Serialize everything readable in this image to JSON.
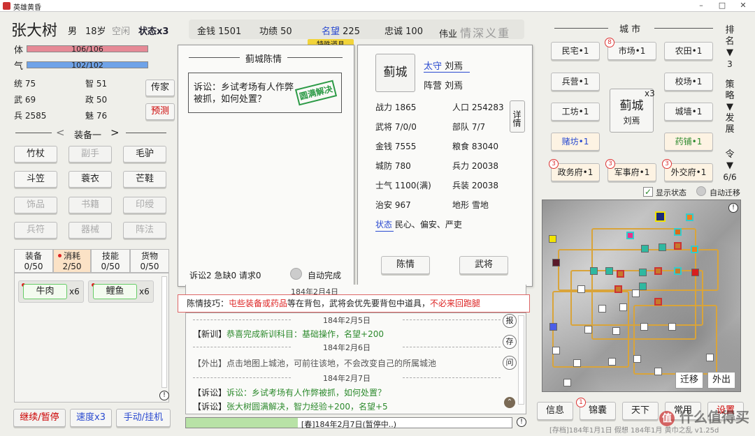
{
  "window": {
    "title": "英雄黄昏",
    "controls": [
      "–",
      "□",
      "✕"
    ]
  },
  "hero": {
    "name": "张大树",
    "gender": "男",
    "age": "18岁",
    "state": "空闲",
    "status": "状态x3"
  },
  "bars": {
    "hp_label": "体",
    "hp_text": "106/106",
    "hp_fraction": 1.0,
    "qi_label": "气",
    "qi_text": "102/102",
    "qi_fraction": 1.0,
    "hp_color": "#e68a96",
    "qi_color": "#6fa3e8"
  },
  "attrs": [
    {
      "l": "统",
      "v": "75"
    },
    {
      "l": "智",
      "v": "51"
    },
    {
      "l": "武",
      "v": "69"
    },
    {
      "l": "政",
      "v": "50"
    },
    {
      "l": "兵",
      "v": "2585"
    },
    {
      "l": "魅",
      "v": "76"
    }
  ],
  "hero_buttons": {
    "chuanjia": "传家",
    "yuce": "预测"
  },
  "equip": {
    "title": "装备一",
    "slots": [
      "竹杖",
      "副手",
      "毛驴",
      "斗笠",
      "蓑衣",
      "芒鞋",
      "饰品",
      "书籍",
      "印绶",
      "兵符",
      "器械",
      "阵法"
    ]
  },
  "bag_tabs": [
    {
      "label": "装备",
      "count": "0/50"
    },
    {
      "label": "消耗",
      "count": "2/50"
    },
    {
      "label": "技能",
      "count": "0/50"
    },
    {
      "label": "货物",
      "count": "0/50"
    }
  ],
  "bag_items": [
    {
      "name": "牛肉",
      "qty": "x6"
    },
    {
      "name": "鲤鱼",
      "qty": "x6"
    }
  ],
  "bottom_buttons": {
    "continue": "继续/暂停",
    "speed": "速度x3",
    "manual": "手动/挂机"
  },
  "topstats": [
    {
      "l": "金钱",
      "v": "1501"
    },
    {
      "l": "功绩",
      "v": "50"
    },
    {
      "l": "名望",
      "v": "225"
    },
    {
      "l": "忠诚",
      "v": "100"
    }
  ],
  "weiye": {
    "label": "伟业",
    "value": "情深义重"
  },
  "tooltip": "特殊道具",
  "petition": {
    "title": "蓟城陈情",
    "item_text": "诉讼：乡试考场有人作弊被抓，如何处置？",
    "stamp": "圆满解决",
    "footer": "诉讼2 急缺0 请求0",
    "auto": "自动完成"
  },
  "city": {
    "name": "蓟城",
    "governor_label": "太守",
    "governor": "刘焉",
    "camp_label": "阵营",
    "camp": "刘焉",
    "detail_button": "详情",
    "stats": [
      {
        "l": "战力",
        "v": "1865"
      },
      {
        "l": "人口",
        "v": "254283"
      },
      {
        "l": "武将",
        "v": "7/0/0"
      },
      {
        "l": "部队",
        "v": "7/7"
      },
      {
        "l": "金钱",
        "v": "7555"
      },
      {
        "l": "粮食",
        "v": "83040"
      },
      {
        "l": "城防",
        "v": "780"
      },
      {
        "l": "兵力",
        "v": "20038"
      },
      {
        "l": "士气",
        "v": "1100(满)"
      },
      {
        "l": "兵装",
        "v": "20038"
      },
      {
        "l": "治安",
        "v": "967"
      },
      {
        "l": "地形",
        "v": "雪地"
      }
    ],
    "status_label": "状态",
    "status_value": "民心、偏安、严吏",
    "btn_chenqing": "陈情",
    "btn_wujiang": "武将"
  },
  "tip": {
    "prefix": "陈情技巧：",
    "highlight1": "屯些装备或药品",
    "mid": "等在背包，武将会优先要背包中道具，",
    "highlight2": "不必来回跑腿"
  },
  "log": {
    "partial_date": "184年2月4日",
    "entries": [
      {
        "date": "184年2月5日",
        "tag": "【新训】",
        "text": "恭喜完成新训科目：基础操作，名望+200",
        "color": "#2d8a2d"
      },
      {
        "date": "184年2月6日",
        "tag": "【外出】",
        "text": "点击地图上城池，可前往该地，不会改变自己的所属城池",
        "color": "#555555"
      },
      {
        "date": "184年2月7日",
        "tag": "【诉讼】",
        "text": "诉讼：乡试考场有人作弊被抓，如何处置？",
        "color": "#2d8a2d"
      },
      {
        "date": "",
        "tag": "【诉讼】",
        "text": "张大树圆满解决，智力经验+200，名望+5",
        "color": "#2d8a2d"
      }
    ],
    "side": [
      "报",
      "存",
      "问"
    ]
  },
  "statusbar": "[春]184年2月7日(暂停中..)",
  "city_panel": {
    "header": "城 市",
    "center_name": "蓟城",
    "center_owner": "刘焉",
    "center_count": "x3",
    "buttons": [
      {
        "label": "民宅•1",
        "badge": ""
      },
      {
        "label": "市场•1",
        "badge": "8"
      },
      {
        "label": "农田•1",
        "badge": ""
      },
      {
        "label": "兵营•1",
        "badge": ""
      },
      {
        "label": "校场•1",
        "badge": ""
      },
      {
        "label": "工坊•1",
        "badge": ""
      },
      {
        "label": "城墙•1",
        "badge": ""
      },
      {
        "label": "赌坊•1",
        "badge": ""
      },
      {
        "label": "药铺•1",
        "badge": ""
      },
      {
        "label": "政务府•1",
        "badge": "3"
      },
      {
        "label": "军事府•1",
        "badge": "3"
      },
      {
        "label": "外交府•1",
        "badge": "3"
      }
    ]
  },
  "right_side": {
    "rank_label": "排名",
    "rank": "3",
    "strategy": "策略",
    "develop": "发展",
    "orders_label": "令",
    "orders": "6/6"
  },
  "map_options": {
    "show_status": "显示状态",
    "auto_migrate": "自动迁移",
    "btn_migrate": "迁移",
    "btn_out": "外出"
  },
  "bottom_right": [
    {
      "label": "信息",
      "badge": ""
    },
    {
      "label": "锦囊",
      "badge": "1"
    },
    {
      "label": "天下",
      "badge": ""
    },
    {
      "label": "常用",
      "badge": ""
    },
    {
      "label": "设置",
      "badge": ""
    }
  ],
  "version": "[存档]184年1月1日 假想 184年1月 黄巾之乱 v1.25d",
  "watermark": "什么值得买"
}
